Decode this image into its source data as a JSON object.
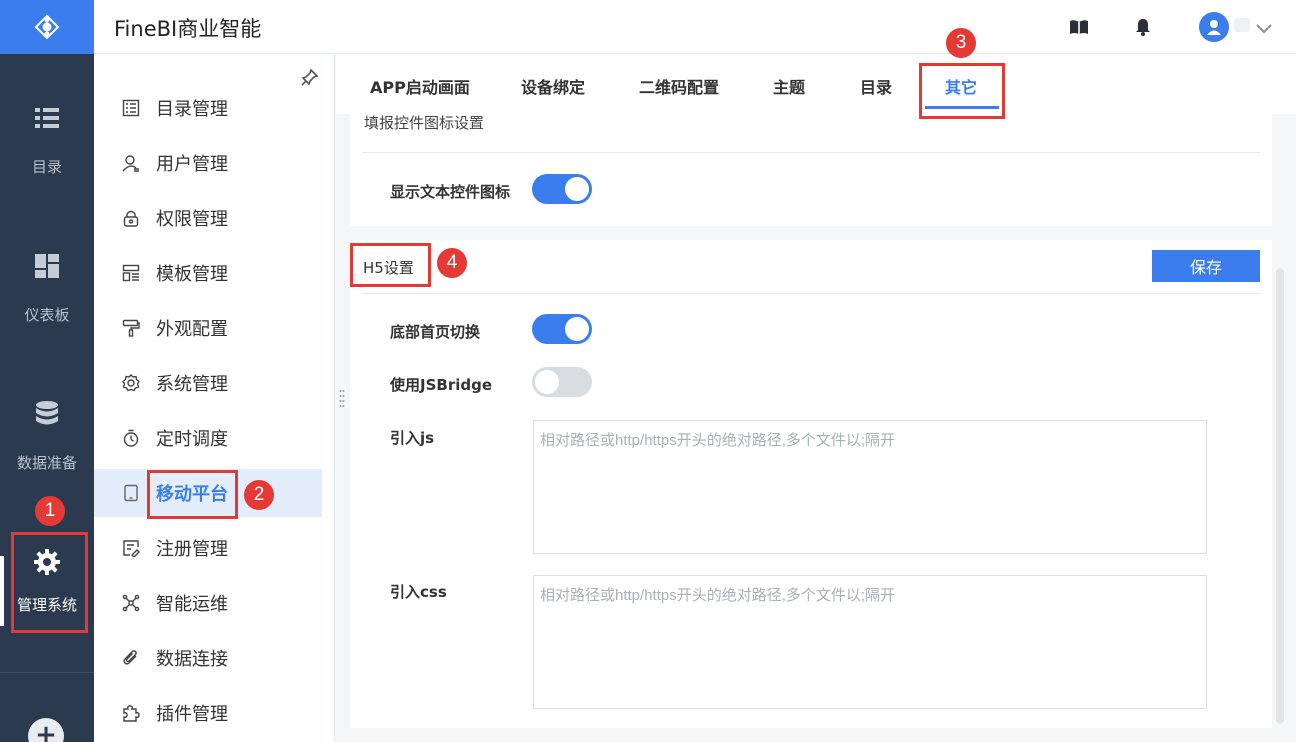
{
  "header": {
    "app_title": "FineBI商业智能"
  },
  "rail": {
    "items": [
      {
        "label": "目录",
        "icon": "list-icon"
      },
      {
        "label": "仪表板",
        "icon": "dashboard-icon"
      },
      {
        "label": "数据准备",
        "icon": "database-icon"
      },
      {
        "label": "管理系统",
        "icon": "gear-icon",
        "active": true
      }
    ],
    "plus": "+"
  },
  "menu": {
    "items": [
      {
        "label": "目录管理",
        "icon": "catalog-icon"
      },
      {
        "label": "用户管理",
        "icon": "user-icon"
      },
      {
        "label": "权限管理",
        "icon": "lock-icon"
      },
      {
        "label": "模板管理",
        "icon": "template-icon"
      },
      {
        "label": "外观配置",
        "icon": "brush-icon"
      },
      {
        "label": "系统管理",
        "icon": "gear-icon"
      },
      {
        "label": "定时调度",
        "icon": "timer-icon"
      },
      {
        "label": "移动平台",
        "icon": "tablet-icon",
        "active": true
      },
      {
        "label": "注册管理",
        "icon": "register-icon"
      },
      {
        "label": "智能运维",
        "icon": "network-icon"
      },
      {
        "label": "数据连接",
        "icon": "clip-icon"
      },
      {
        "label": "插件管理",
        "icon": "puzzle-icon"
      }
    ]
  },
  "tabs": [
    {
      "label": "APP启动画面"
    },
    {
      "label": "设备绑定"
    },
    {
      "label": "二维码配置"
    },
    {
      "label": "主题"
    },
    {
      "label": "目录"
    },
    {
      "label": "其它",
      "active": true
    }
  ],
  "fill_section": {
    "title": "填报控件图标设置",
    "show_text_icon_label": "显示文本控件图标",
    "show_text_icon_on": true
  },
  "h5_section": {
    "title": "H5设置",
    "save_label": "保存",
    "bottom_home_switch_label": "底部首页切换",
    "bottom_home_switch_on": true,
    "jsbridge_label": "使用JSBridge",
    "jsbridge_on": false,
    "js_label": "引入js",
    "js_placeholder": "相对路径或http/https开头的绝对路径,多个文件以;隔开",
    "css_label": "引入css",
    "css_placeholder": "相对路径或http/https开头的绝对路径,多个文件以;隔开"
  },
  "annotations": [
    "1",
    "2",
    "3",
    "4"
  ],
  "colors": {
    "accent": "#3b7ded",
    "rail_bg": "#2c3a4f",
    "annotation": "#e53935"
  }
}
